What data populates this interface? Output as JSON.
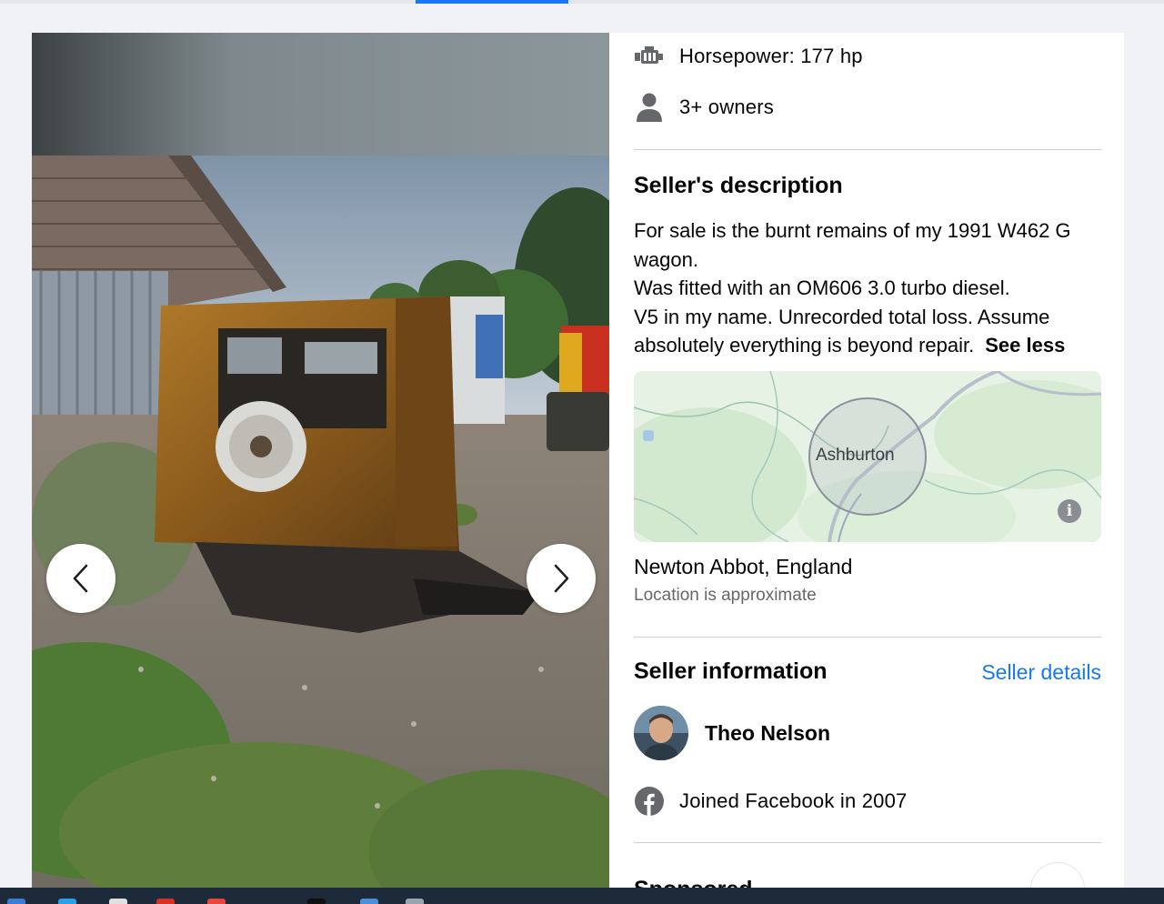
{
  "specs": {
    "horsepower": "Horsepower: 177 hp",
    "owners": "3+ owners"
  },
  "description": {
    "title": "Seller's description",
    "lines": [
      "For sale is the burnt remains of my 1991 W462 G",
      "wagon.",
      "Was fitted with an OM606 3.0 turbo diesel.",
      "V5 in my name. Unrecorded total loss. Assume",
      "absolutely everything is beyond repair."
    ],
    "toggle_label": "See less"
  },
  "map": {
    "town_label": "Ashburton",
    "info_glyph": "i"
  },
  "location": {
    "name": "Newton Abbot, England",
    "note": "Location is approximate"
  },
  "seller": {
    "section_title": "Seller information",
    "details_link": "Seller details",
    "name": "Theo Nelson",
    "joined": "Joined Facebook in 2007"
  },
  "sponsored": {
    "title": "Sponsored"
  },
  "icons": {
    "engine": "engine-icon",
    "person": "person-icon",
    "facebook": "facebook-icon",
    "prev": "chevron-left-icon",
    "next": "chevron-right-icon"
  },
  "colors": {
    "link": "#1877f2",
    "map_circle": "#8a8f9c"
  }
}
